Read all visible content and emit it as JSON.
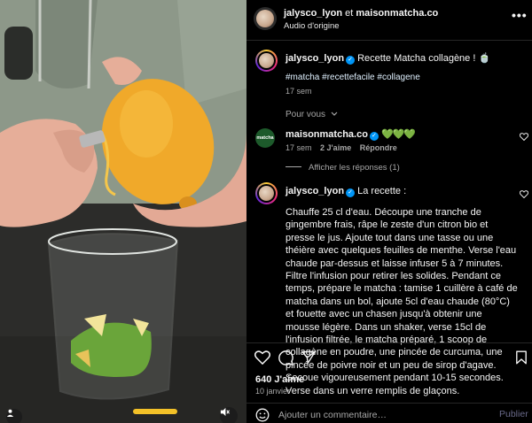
{
  "colors": {
    "background": "#000000",
    "verified": "#0095f6",
    "hashtag": "#e0f1ff",
    "muted": "#a8a8a8",
    "publish": "#6a6a8a"
  },
  "header": {
    "user1": "jalysco_lyon",
    "joiner": "et",
    "user2": "maisonmatcha.co",
    "audio": "Audio d'origine",
    "more_icon": "more-horizontal-icon"
  },
  "caption": {
    "username": "jalysco_lyon",
    "text": "Recette Matcha collagène ! 🍵",
    "hashtags": "#matcha #recettefacile #collagene",
    "time": "17 sem"
  },
  "pour_vous": {
    "label": "Pour vous",
    "chevron": "chevron-down-icon"
  },
  "comment1": {
    "avatar_text": "matcha",
    "username": "maisonmatcha.co",
    "text": "💚💚💚",
    "time": "17 sem",
    "likes": "2 J'aime",
    "reply": "Répondre",
    "show_replies": "Afficher les réponses (1)"
  },
  "comment2": {
    "username": "jalysco_lyon",
    "title": "La recette :",
    "body": "Chauffe 25 cl d'eau. Découpe une tranche de gingembre frais, râpe le zeste d'un citron bio et presse le jus. Ajoute tout dans une tasse ou une théière avec quelques feuilles de menthe. Verse l'eau chaude par-dessus et laisse infuser 5 à 7 minutes. Filtre l'infusion pour retirer les solides. Pendant ce temps, prépare le matcha : tamise 1 cuillère à café de matcha dans un bol, ajoute 5cl d'eau chaude (80°C) et fouette avec un chasen jusqu'à obtenir une mousse légère. Dans un shaker, verse 15cl de l'infusion filtrée, le matcha préparé, 1 scoop de collagène en poudre, une pincée de curcuma, une pincée de poivre noir et un peu de sirop d'agave. Secoue vigoureusement pendant 10-15 secondes. Verse dans un verre remplis de glaçons."
  },
  "actions": {
    "like": "heart-icon",
    "comment": "comment-icon",
    "share": "share-icon",
    "save": "bookmark-icon"
  },
  "likes_count": "640 J'aime",
  "date": "10 janvier",
  "composer": {
    "placeholder": "Ajouter un commentaire…",
    "publish": "Publier",
    "emoji_icon": "emoji-icon"
  },
  "media": {
    "user_icon": "user-tag-icon",
    "mute_icon": "mute-icon"
  }
}
